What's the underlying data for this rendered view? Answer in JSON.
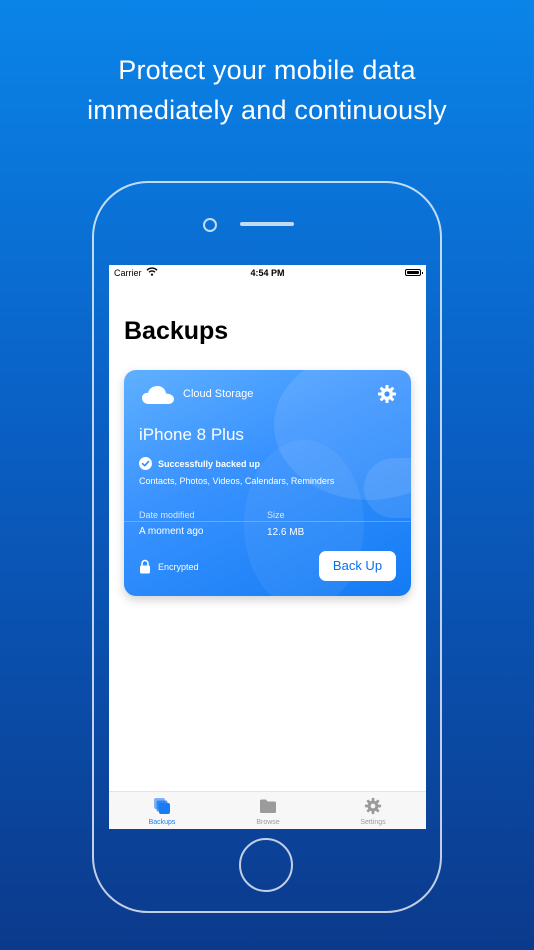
{
  "headline": {
    "line1": "Protect your mobile data",
    "line2": "immediately and continuously"
  },
  "status_bar": {
    "carrier": "Carrier",
    "time": "4:54 PM"
  },
  "page": {
    "title": "Backups"
  },
  "card": {
    "storage_label": "Cloud Storage",
    "device_name": "iPhone 8 Plus",
    "status": "Successfully backed up",
    "contents": "Contacts, Photos, Videos, Calendars, Reminders",
    "date_label": "Date modified",
    "date_value": "A moment ago",
    "size_label": "Size",
    "size_value": "12.6 MB",
    "encryption": "Encrypted",
    "backup_button": "Back Up",
    "icons": [
      "cloud-icon",
      "gear-icon",
      "checkmark-icon",
      "lock-icon"
    ]
  },
  "tabs": [
    {
      "label": "Backups",
      "icon": "backups-icon",
      "active": true
    },
    {
      "label": "Browse",
      "icon": "folder-icon",
      "active": false
    },
    {
      "label": "Settings",
      "icon": "gear-icon",
      "active": false
    }
  ],
  "colors": {
    "background_top": "#0a84e8",
    "background_bottom": "#0b3a8c",
    "accent": "#0a6ff0",
    "card": "#3a93ff",
    "tab_inactive": "#9b9b9b"
  }
}
